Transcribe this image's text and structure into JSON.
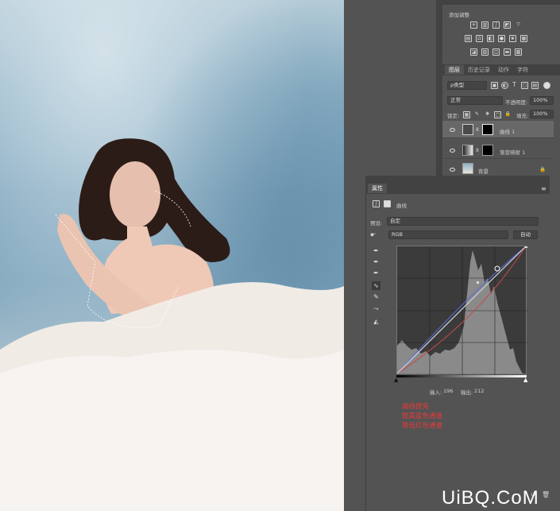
{
  "adjustments": {
    "title": "添加调整"
  },
  "layers_panel": {
    "tabs": [
      "图层",
      "历史记录",
      "动作",
      "字符"
    ],
    "filter_select": "ρ类型",
    "blend_mode": "正常",
    "opacity_label": "不透明度:",
    "opacity_value": "100%",
    "lock_label": "锁定:",
    "fill_label": "填充:",
    "fill_value": "100%",
    "layers": [
      {
        "name": "曲线 1"
      },
      {
        "name": "渐变映射 1"
      },
      {
        "name": "背景"
      }
    ]
  },
  "properties_panel": {
    "title": "属性",
    "adjustment_name": "曲线",
    "preset_label": "预设:",
    "preset_value": "自定",
    "channel_value": "RGB",
    "auto_button": "自动",
    "input_label": "输入:",
    "input_value": "196",
    "output_label": "输出:",
    "output_value": "212",
    "notes": [
      "曲线提亮",
      "提高蓝色通道",
      "降低红色通道"
    ]
  },
  "watermark": "UiBQ.CoM",
  "colors": {
    "panel_bg": "#535353",
    "dark_strip": "#424242",
    "annotation": "#e8393a",
    "curve_rgb": "#d0d0e0",
    "curve_blue": "#5a6cd8",
    "curve_red": "#c84848"
  }
}
